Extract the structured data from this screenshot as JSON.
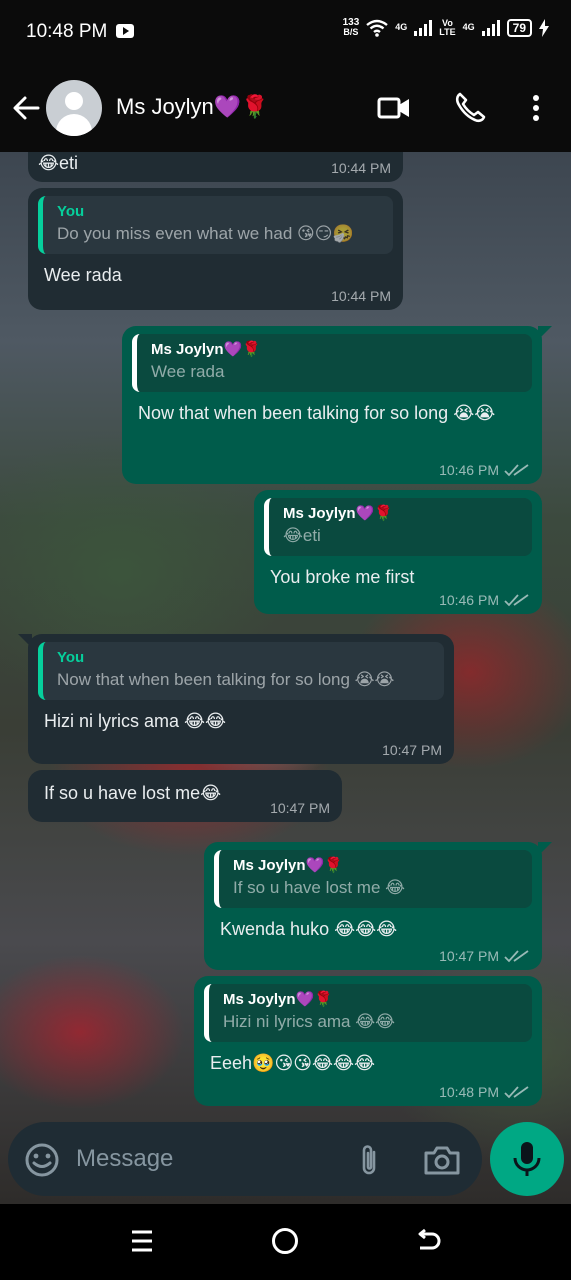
{
  "status_bar": {
    "time": "10:48 PM",
    "net_speed_value": "133",
    "net_speed_unit": "B/S",
    "sim1_label": "4G",
    "volte_top": "Vo",
    "volte_bottom": "LTE",
    "sim2_label": "4G",
    "battery": "79"
  },
  "header": {
    "contact_name": "Ms Joylyn💜🌹"
  },
  "messages": [
    {
      "direction": "in",
      "text": "😂eti",
      "time": "10:44 PM"
    },
    {
      "direction": "in",
      "quote_author": "You",
      "quote_text": "Do you miss even what we had 😘😏🤧",
      "text": "Wee rada",
      "time": "10:44 PM"
    },
    {
      "direction": "out",
      "quote_author": "Ms Joylyn💜🌹",
      "quote_text": "Wee rada",
      "text": "Now that  when been talking for so long 😭😭",
      "time": "10:46 PM"
    },
    {
      "direction": "out",
      "quote_author": "Ms Joylyn💜🌹",
      "quote_text": "😂eti",
      "text": "You broke me first",
      "time": "10:46 PM"
    },
    {
      "direction": "in",
      "quote_author": "You",
      "quote_text": "Now that  when been talking for so long 😭😭",
      "text": "Hizi ni lyrics ama 😂😂",
      "time": "10:47 PM"
    },
    {
      "direction": "in",
      "text": "If so  u have lost me😂",
      "time": "10:47 PM"
    },
    {
      "direction": "out",
      "quote_author": "Ms Joylyn💜🌹",
      "quote_text": "If so  u have lost me 😂",
      "text": "Kwenda huko 😂😂😂",
      "time": "10:47 PM"
    },
    {
      "direction": "out",
      "quote_author": "Ms Joylyn💜🌹",
      "quote_text": "Hizi ni lyrics ama 😂😂",
      "text": "Eeeh🥹😘😘😂😂😂",
      "time": "10:48 PM"
    }
  ],
  "composer": {
    "placeholder": "Message"
  },
  "colors": {
    "incoming_bubble": "#202c33",
    "outgoing_bubble": "#005c4b",
    "accent": "#00a884",
    "quote_you": "#06cf9c"
  }
}
